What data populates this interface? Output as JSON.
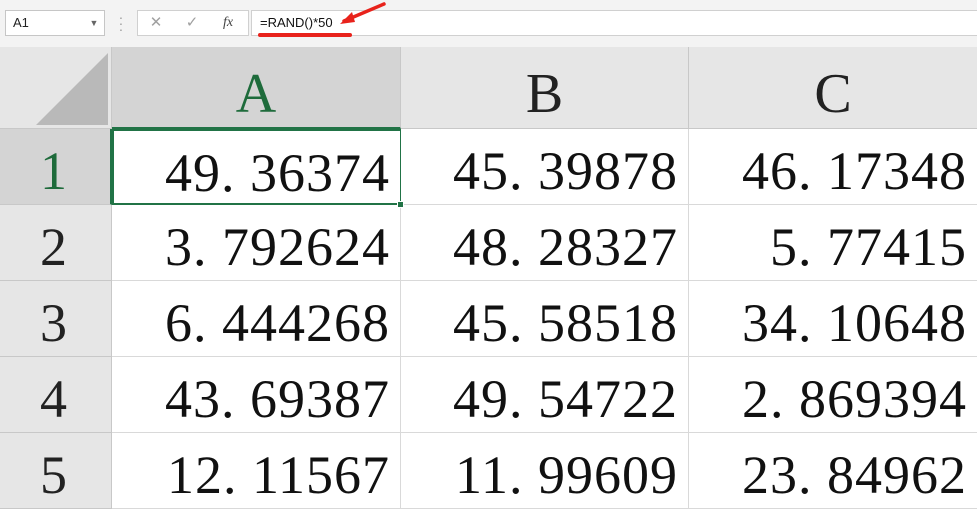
{
  "formula_bar": {
    "name_box": "A1",
    "cancel_icon": "✕",
    "enter_icon": "✓",
    "fx_label": "fx",
    "formula": "=RAND()*50"
  },
  "annotation": {
    "underline_color": "#e8221b",
    "arrow_color": "#e8221b"
  },
  "sheet": {
    "columns": [
      "A",
      "B",
      "C"
    ],
    "rows": [
      {
        "label": "1",
        "cells": [
          "49. 36374",
          "45. 39878",
          "46. 17348"
        ]
      },
      {
        "label": "2",
        "cells": [
          "3. 792624",
          "48. 28327",
          "5. 77415"
        ]
      },
      {
        "label": "3",
        "cells": [
          "6. 444268",
          "45. 58518",
          "34. 10648"
        ]
      },
      {
        "label": "4",
        "cells": [
          "43. 69387",
          "49. 54722",
          "2. 869394"
        ]
      },
      {
        "label": "5",
        "cells": [
          "12. 11567",
          "11. 99609",
          "23. 84962"
        ]
      }
    ],
    "selected_cell": "A1",
    "accent_color": "#217346"
  }
}
